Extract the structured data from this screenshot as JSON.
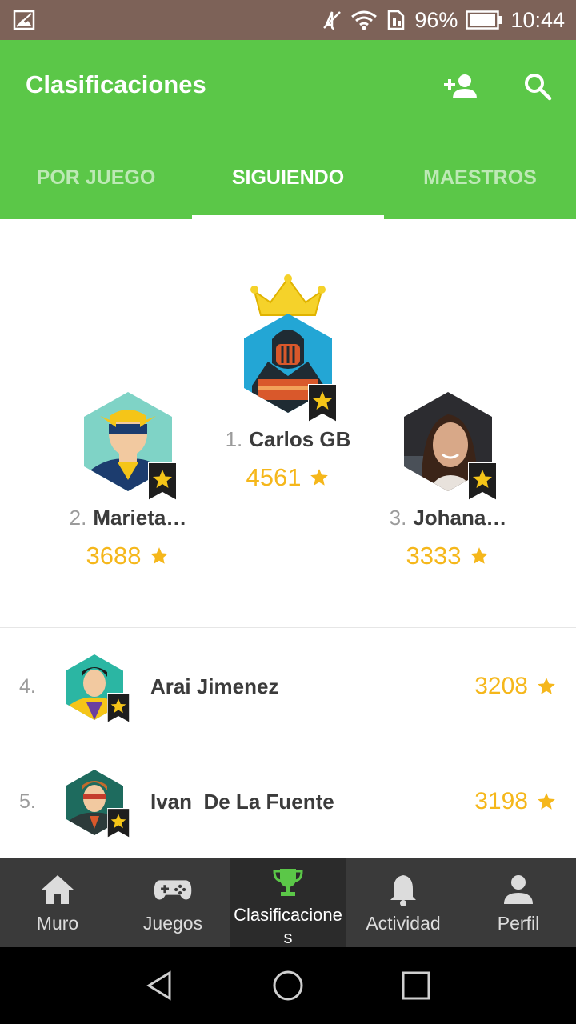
{
  "status_bar": {
    "battery": "96%",
    "time": "10:44"
  },
  "app_bar": {
    "title": "Clasificaciones"
  },
  "tabs": [
    {
      "label": "POR JUEGO",
      "active": false
    },
    {
      "label": "SIGUIENDO",
      "active": true
    },
    {
      "label": "MAESTROS",
      "active": false
    }
  ],
  "podium": {
    "first": {
      "rank": "1.",
      "name": "Carlos GB",
      "score": "4561"
    },
    "second": {
      "rank": "2.",
      "name": "Marieta…",
      "score": "3688"
    },
    "third": {
      "rank": "3.",
      "name": "Johana…",
      "score": "3333"
    }
  },
  "list": [
    {
      "rank": "4.",
      "name": "Arai Jimenez",
      "score": "3208"
    },
    {
      "rank": "5.",
      "name": "Ivan  De La Fuente",
      "score": "3198"
    }
  ],
  "bottom_nav": [
    {
      "label": "Muro",
      "icon": "home-icon"
    },
    {
      "label": "Juegos",
      "icon": "gamepad-icon"
    },
    {
      "label": "Clasificaciones",
      "icon": "trophy-icon",
      "active": true
    },
    {
      "label": "Actividad",
      "icon": "bell-icon"
    },
    {
      "label": "Perfil",
      "icon": "person-icon"
    }
  ],
  "colors": {
    "primary": "#5bc748",
    "score": "#f5b71b",
    "nav_bg": "#3a3a3a",
    "status_bar": "#7d6258"
  }
}
